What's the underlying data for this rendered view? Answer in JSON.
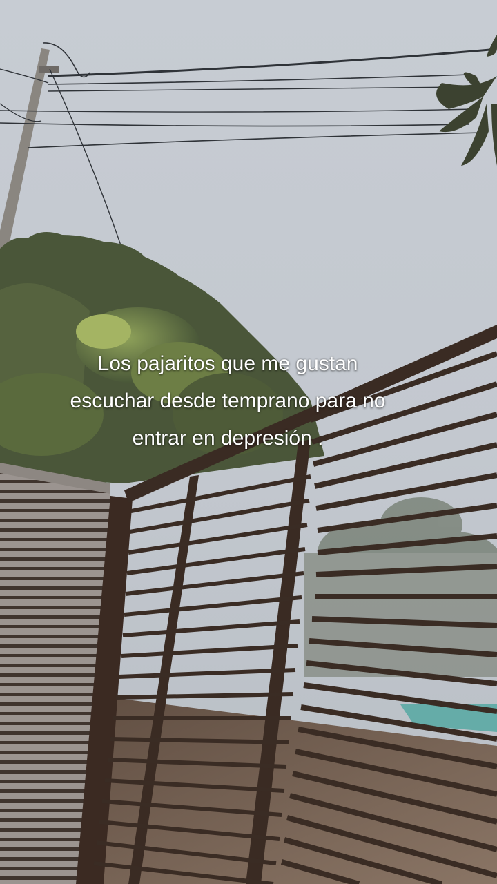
{
  "caption": {
    "line1": "Los pajaritos que me gustan",
    "line2": "escuchar desde temprano para no",
    "line3": "entrar en depresión ."
  },
  "colors": {
    "sky": "#c3c8cd",
    "foliage": "#4e5a3d",
    "foliage_light": "#9aae5c",
    "gate": "#3a2c24",
    "caption_text": "#ffffff"
  }
}
